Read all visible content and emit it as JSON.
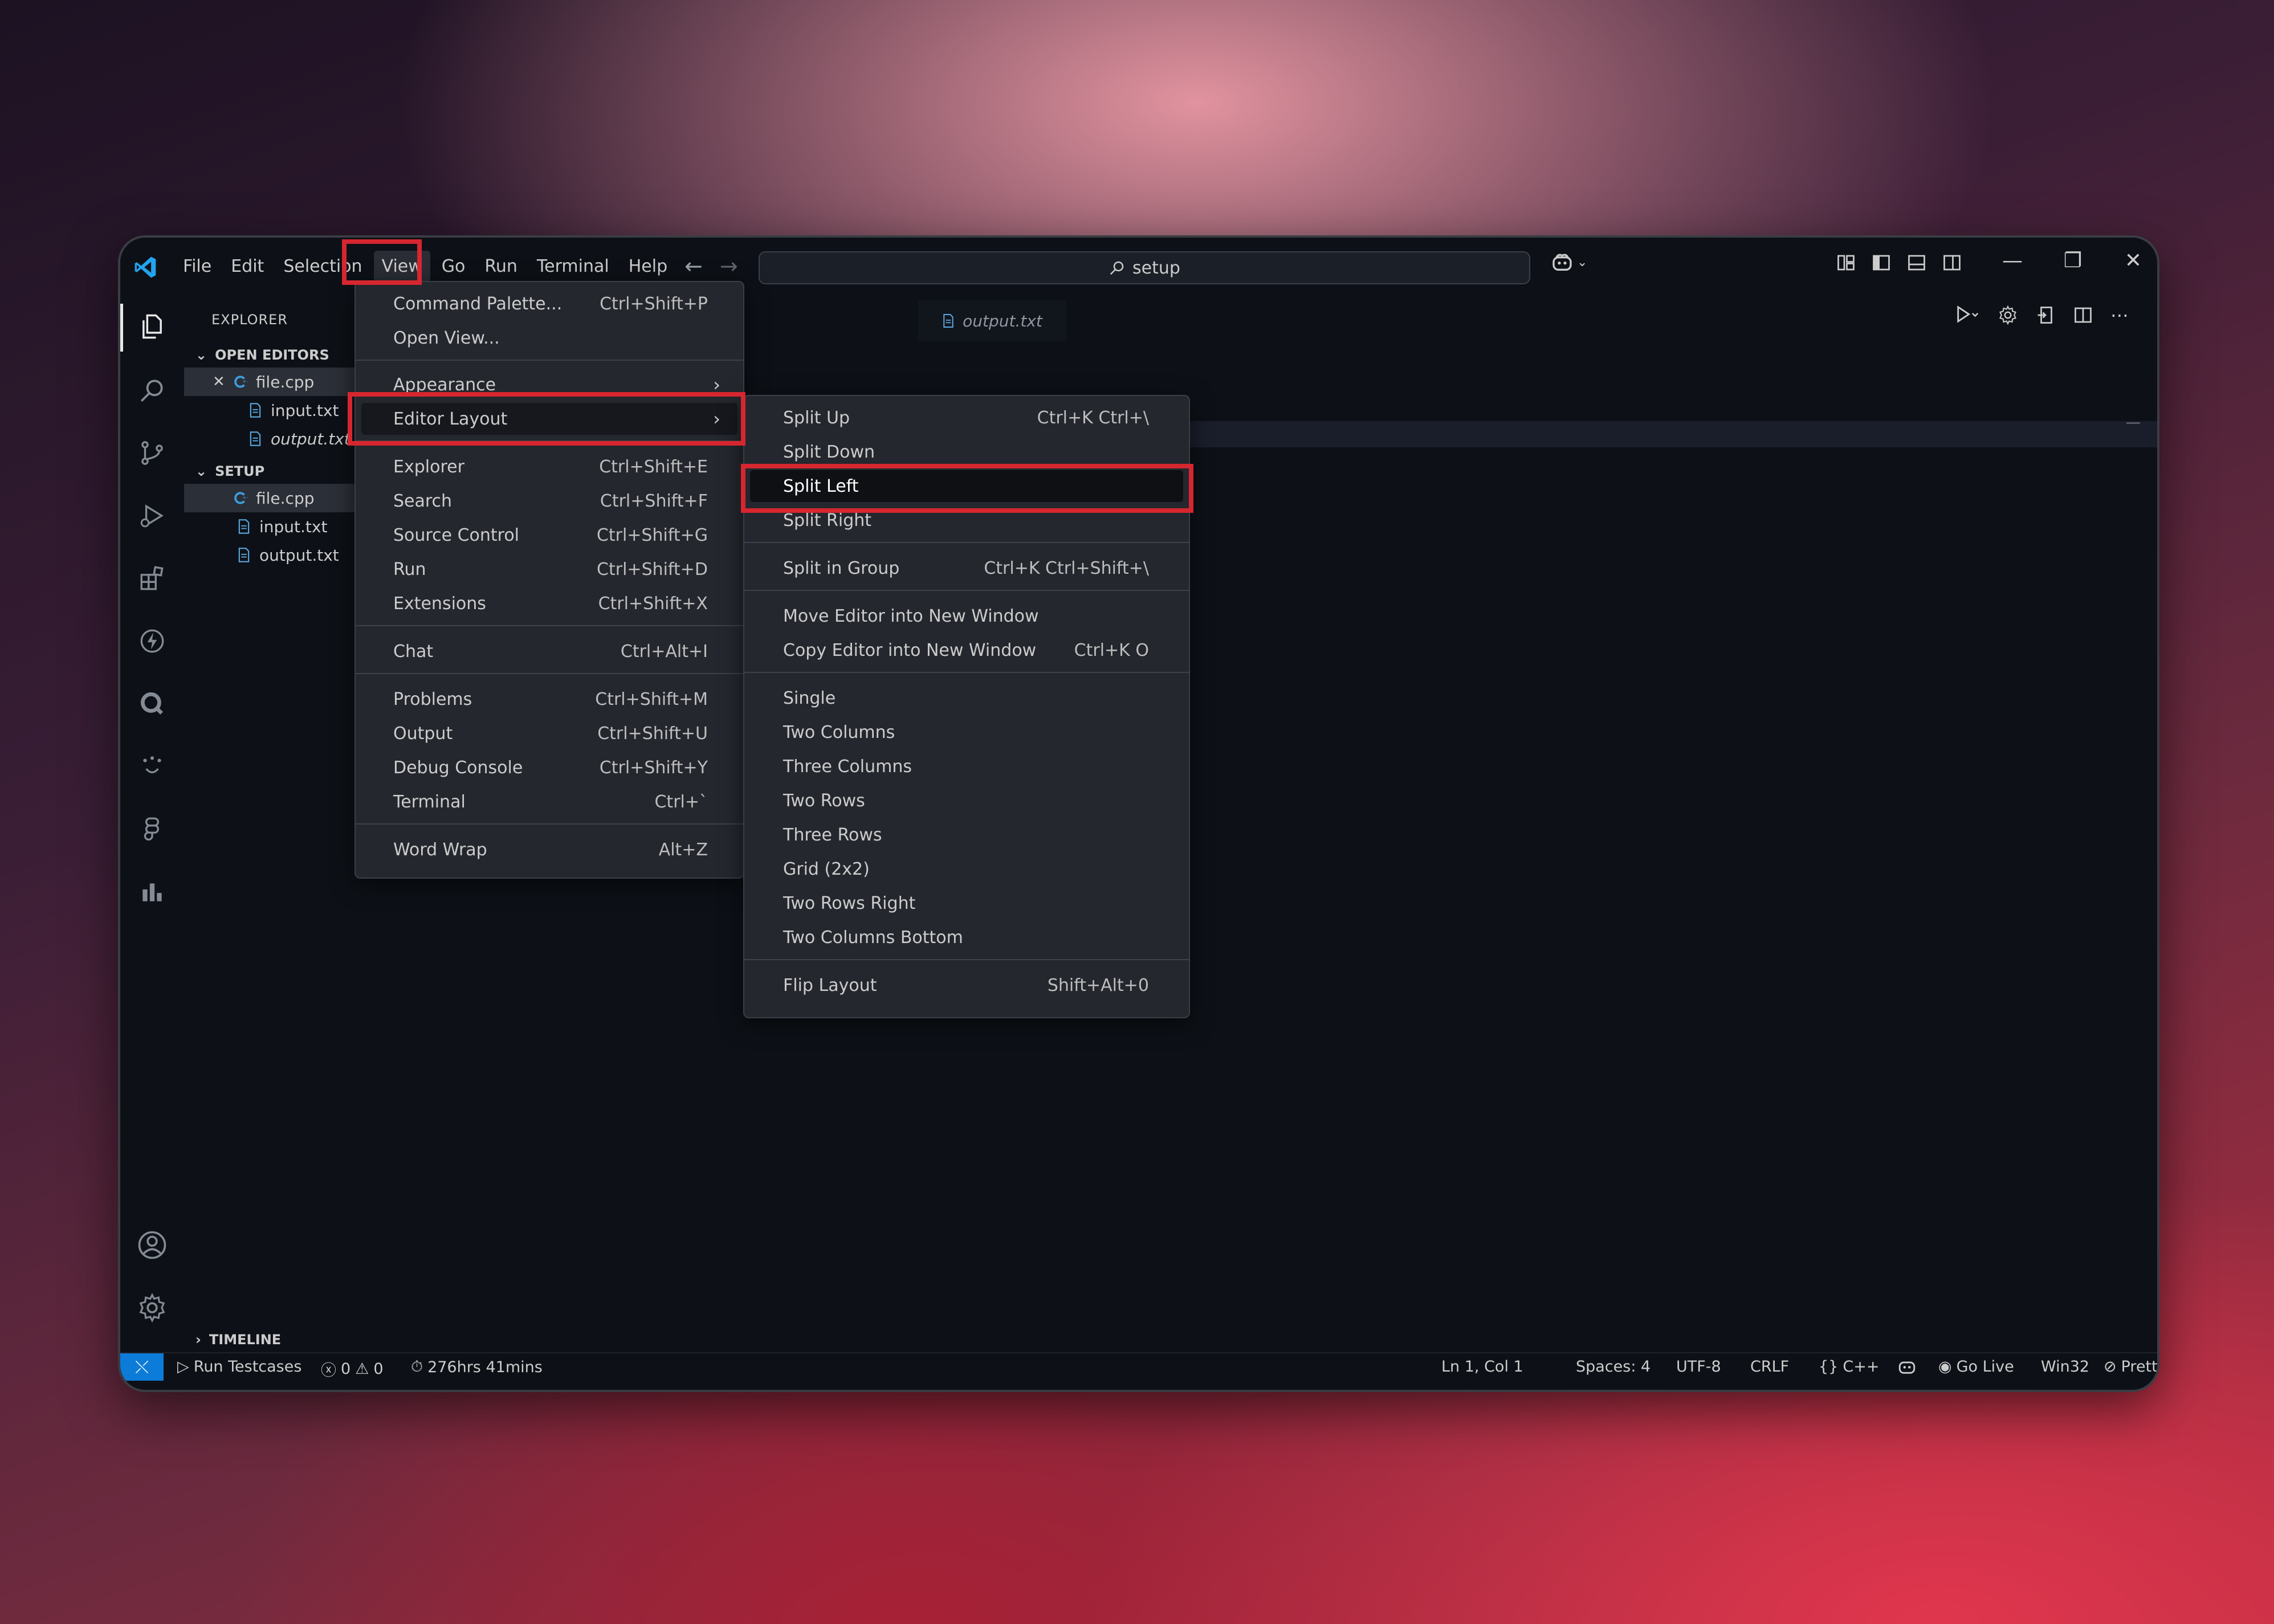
{
  "titlebar": {
    "menu": [
      "File",
      "Edit",
      "Selection",
      "View",
      "Go",
      "Run",
      "Terminal",
      "Help"
    ],
    "search_text": "setup",
    "window_controls": [
      "minimize-icon",
      "restore-icon",
      "close-icon"
    ]
  },
  "sidebar": {
    "title": "EXPLORER",
    "open_editors_label": "OPEN EDITORS",
    "open_editors": [
      {
        "name": "file.cpp",
        "icon": "cpp-file-icon"
      },
      {
        "name": "input.txt",
        "icon": "text-file-icon"
      },
      {
        "name": "output.txt",
        "icon": "text-file-icon"
      }
    ],
    "folder_label": "SETUP",
    "files": [
      {
        "name": "file.cpp",
        "icon": "cpp-file-icon"
      },
      {
        "name": "input.txt",
        "icon": "text-file-icon"
      },
      {
        "name": "output.txt",
        "icon": "text-file-icon"
      }
    ],
    "timeline_label": "TIMELINE"
  },
  "editor": {
    "tab_label": "output.txt"
  },
  "view_menu": {
    "items": [
      {
        "label": "Command Palette...",
        "shortcut": "Ctrl+Shift+P"
      },
      {
        "label": "Open View...",
        "shortcut": ""
      },
      {
        "label": "Appearance",
        "shortcut": ""
      },
      {
        "label": "Editor Layout",
        "shortcut": ""
      },
      {
        "label": "Explorer",
        "shortcut": "Ctrl+Shift+E"
      },
      {
        "label": "Search",
        "shortcut": "Ctrl+Shift+F"
      },
      {
        "label": "Source Control",
        "shortcut": "Ctrl+Shift+G"
      },
      {
        "label": "Run",
        "shortcut": "Ctrl+Shift+D"
      },
      {
        "label": "Extensions",
        "shortcut": "Ctrl+Shift+X"
      },
      {
        "label": "Chat",
        "shortcut": "Ctrl+Alt+I"
      },
      {
        "label": "Problems",
        "shortcut": "Ctrl+Shift+M"
      },
      {
        "label": "Output",
        "shortcut": "Ctrl+Shift+U"
      },
      {
        "label": "Debug Console",
        "shortcut": "Ctrl+Shift+Y"
      },
      {
        "label": "Terminal",
        "shortcut": "Ctrl+`"
      },
      {
        "label": "Word Wrap",
        "shortcut": "Alt+Z"
      }
    ]
  },
  "editor_layout_menu": {
    "items": [
      {
        "label": "Split Up",
        "shortcut": "Ctrl+K Ctrl+\\"
      },
      {
        "label": "Split Down",
        "shortcut": ""
      },
      {
        "label": "Split Left",
        "shortcut": ""
      },
      {
        "label": "Split Right",
        "shortcut": ""
      },
      {
        "label": "Split in Group",
        "shortcut": "Ctrl+K Ctrl+Shift+\\"
      },
      {
        "label": "Move Editor into New Window",
        "shortcut": ""
      },
      {
        "label": "Copy Editor into New Window",
        "shortcut": "Ctrl+K O"
      },
      {
        "label": "Single",
        "shortcut": ""
      },
      {
        "label": "Two Columns",
        "shortcut": ""
      },
      {
        "label": "Three Columns",
        "shortcut": ""
      },
      {
        "label": "Two Rows",
        "shortcut": ""
      },
      {
        "label": "Three Rows",
        "shortcut": ""
      },
      {
        "label": "Grid (2x2)",
        "shortcut": ""
      },
      {
        "label": "Two Rows Right",
        "shortcut": ""
      },
      {
        "label": "Two Columns Bottom",
        "shortcut": ""
      },
      {
        "label": "Flip Layout",
        "shortcut": "Shift+Alt+0"
      }
    ]
  },
  "statusbar": {
    "run_testcases": "Run Testcases",
    "errors": "0",
    "warnings": "0",
    "time": "276hrs 41mins",
    "position": "Ln 1, Col 1",
    "spaces": "Spaces: 4",
    "encoding": "UTF-8",
    "eol": "CRLF",
    "language": "C++",
    "go_live": "Go Live",
    "platform": "Win32",
    "prettier": "Prettier"
  },
  "colors": {
    "highlight": "#d6262f",
    "accent": "#0d7bd8",
    "menu_bg": "#24272e",
    "editor_bg": "#0d1117"
  }
}
